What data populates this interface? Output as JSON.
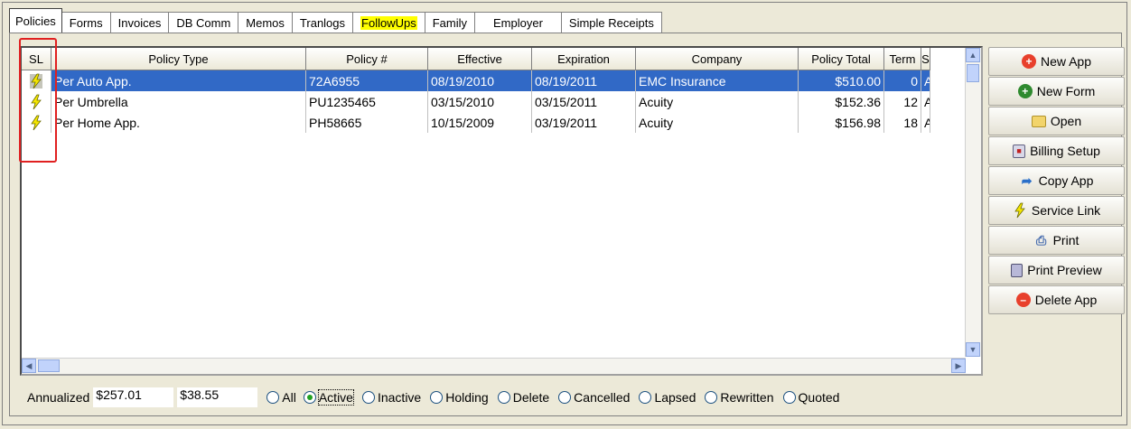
{
  "tabs": [
    {
      "label": "Policies"
    },
    {
      "label": "Forms"
    },
    {
      "label": "Invoices"
    },
    {
      "label": "DB Comm"
    },
    {
      "label": "Memos"
    },
    {
      "label": "Tranlogs"
    },
    {
      "label": "FollowUps"
    },
    {
      "label": "Family"
    },
    {
      "label": "Employer"
    },
    {
      "label": "Simple Receipts"
    }
  ],
  "grid": {
    "columns": [
      "SL",
      "Policy Type",
      "Policy #",
      "Effective",
      "Expiration",
      "Company",
      "Policy Total",
      "Term",
      "S"
    ],
    "rows": [
      {
        "type": "Per Auto App.",
        "policy": "72A6955",
        "effective": "08/19/2010",
        "expiration": "08/19/2011",
        "company": "EMC Insurance",
        "total": "$510.00",
        "term": "0",
        "s": "A",
        "selected": true
      },
      {
        "type": "Per Umbrella",
        "policy": "PU1235465",
        "effective": "03/15/2010",
        "expiration": "03/15/2011",
        "company": "Acuity",
        "total": "$152.36",
        "term": "12",
        "s": "A"
      },
      {
        "type": "Per Home App.",
        "policy": "PH58665",
        "effective": "10/15/2009",
        "expiration": "03/19/2011",
        "company": "Acuity",
        "total": "$156.98",
        "term": "18",
        "s": "A"
      }
    ]
  },
  "buttons": [
    {
      "label": "New App",
      "icon": "plus-red-icon"
    },
    {
      "label": "New Form",
      "icon": "plus-green-icon"
    },
    {
      "label": "Open",
      "icon": "folder-icon"
    },
    {
      "label": "Billing Setup",
      "icon": "billing-icon"
    },
    {
      "label": "Copy App",
      "icon": "copy-icon"
    },
    {
      "label": "Service Link",
      "icon": "lightning-icon"
    },
    {
      "label": "Print",
      "icon": "printer-icon"
    },
    {
      "label": "Print Preview",
      "icon": "print-preview-icon"
    },
    {
      "label": "Delete App",
      "icon": "minus-red-icon"
    }
  ],
  "bottom": {
    "annualized_label": "Annualized",
    "value1": "$257.01",
    "value2": "$38.55",
    "filters": [
      {
        "label": "All",
        "checked": false
      },
      {
        "label": "Active",
        "checked": true
      },
      {
        "label": "Inactive",
        "checked": false
      },
      {
        "label": "Holding",
        "checked": false
      },
      {
        "label": "Delete",
        "checked": false
      },
      {
        "label": "Cancelled",
        "checked": false
      },
      {
        "label": "Lapsed",
        "checked": false
      },
      {
        "label": "Rewritten",
        "checked": false
      },
      {
        "label": "Quoted",
        "checked": false
      }
    ]
  },
  "colors": {
    "selection": "#3169c6",
    "highlight": "#ffff00",
    "annotation": "#e02020"
  }
}
